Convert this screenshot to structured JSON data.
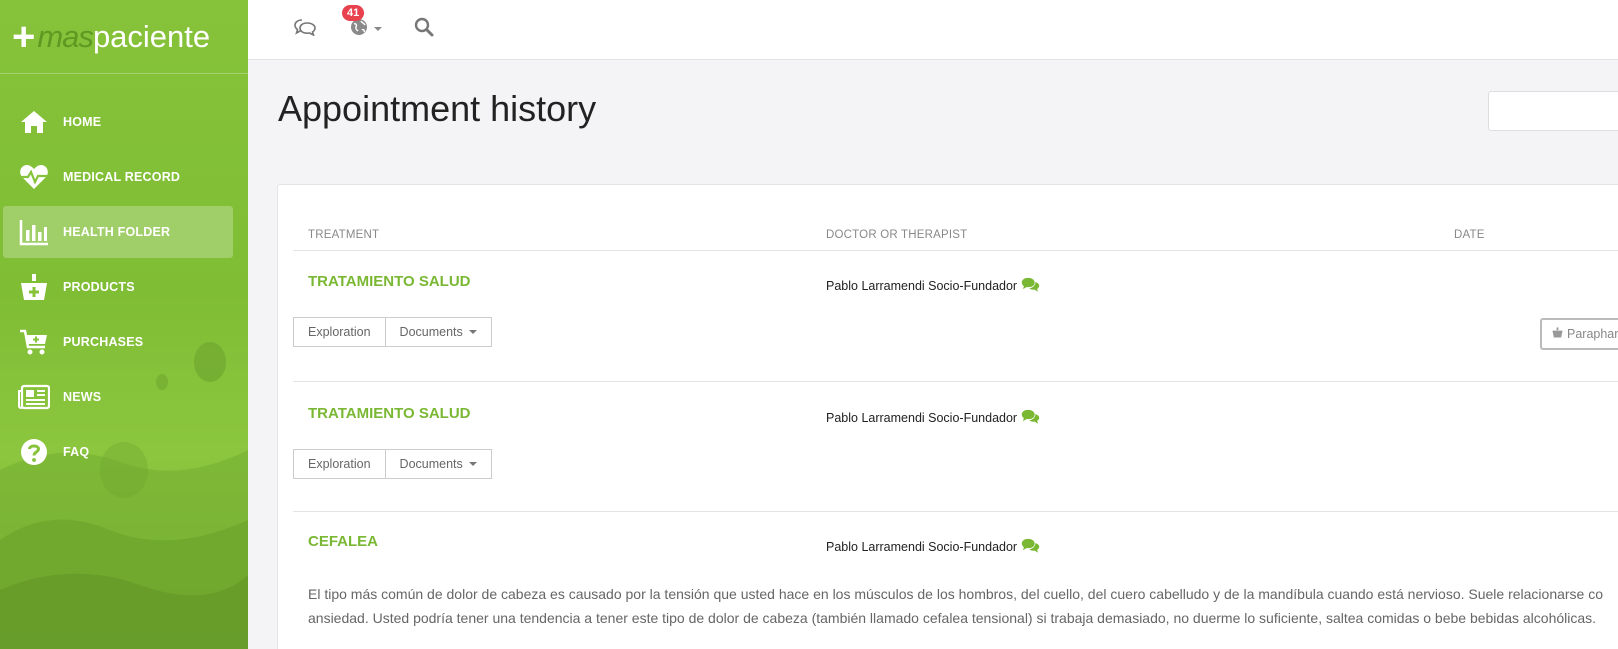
{
  "brand": {
    "plus": "+",
    "mas": "mas",
    "paciente": "paciente"
  },
  "sidebar": {
    "items": [
      {
        "label": "HOME",
        "icon": "home-icon"
      },
      {
        "label": "MEDICAL RECORD",
        "icon": "heartbeat-icon"
      },
      {
        "label": "HEALTH FOLDER",
        "icon": "bar-chart-icon",
        "active": true
      },
      {
        "label": "PRODUCTS",
        "icon": "basket-icon"
      },
      {
        "label": "PURCHASES",
        "icon": "cart-plus-icon"
      },
      {
        "label": "NEWS",
        "icon": "newspaper-icon"
      },
      {
        "label": "FAQ",
        "icon": "question-circle-icon"
      }
    ]
  },
  "topbar": {
    "notifications_count": "41"
  },
  "page": {
    "title": "Appointment history"
  },
  "table": {
    "headers": {
      "treatment": "TREATMENT",
      "doctor": "DOCTOR OR THERAPIST",
      "date": "DATE"
    },
    "rows": [
      {
        "treatment": "TRATAMIENTO SALUD",
        "doctor": "Pablo Larramendi Socio-Fundador",
        "btn_exploration": "Exploration",
        "btn_documents": "Documents",
        "btn_para": "Paraphar"
      },
      {
        "treatment": "TRATAMIENTO SALUD",
        "doctor": "Pablo Larramendi Socio-Fundador",
        "btn_exploration": "Exploration",
        "btn_documents": "Documents"
      },
      {
        "treatment": "CEFALEA",
        "doctor": "Pablo Larramendi Socio-Fundador",
        "description_line1": "El tipo más común de dolor de cabeza es causado por la tensión que usted hace en los músculos de los hombros, del cuello, del cuero cabelludo y de la mandíbula cuando está nervioso. Suele relacionarse co",
        "description_line2": "ansiedad. Usted podría tener una tendencia a tener este tipo de dolor de cabeza (también llamado cefalea tensional) si trabaja demasiado, no duerme lo suficiente, saltea comidas o bebe bebidas alcohólicas."
      }
    ]
  },
  "colors": {
    "sidebar_green": "#86c33a",
    "accent_green": "#7ab834",
    "badge_red": "#e8424f"
  }
}
